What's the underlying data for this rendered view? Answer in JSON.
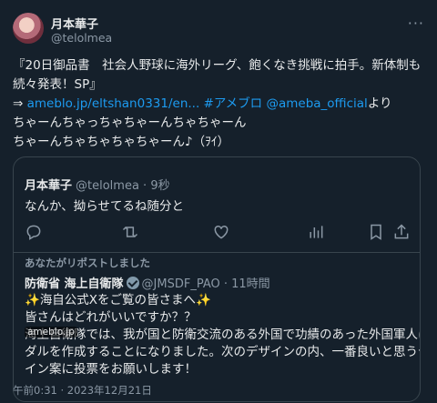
{
  "author": {
    "name": "月本華子",
    "handle": "@telolmea"
  },
  "tweet": {
    "line1": "『20日御品書　社会人野球に海外リーグ、飽くなき挑戦に拍手。新体制も",
    "line2": "続々発表！SP』",
    "arrow": "⇒ ",
    "link": "ameblo.jp/eltshan0331/en...",
    "hashtag": " #アメブロ",
    "mention": " @ameba_official",
    "suffix": "より",
    "line4": "ちゃーんちゃっちゃちゃーんちゃちゃーん",
    "line5": "ちゃーんちゃちゃちゃちゃーん♪（ｦｲ）"
  },
  "quote": {
    "name": "月本華子",
    "meta": "@telolmea · 9秒",
    "text": "なんか、拗らせてるね随分と",
    "repost_label": "あなたがリポストしました",
    "reposted": {
      "name": "防衛省 海上自衛隊",
      "meta": "@JMSDF_PAO · 11時間",
      "line1_sparkle_l": "✨",
      "line1": "海自公式Xをご覧の皆さまへ",
      "line1_sparkle_r": "✨",
      "line2": "皆さんはどれがいいですか？？",
      "line3": "海上自衛隊では、我が国と防衛交流のある外国で功績のあった外国軍人に",
      "line4": "ダルを作成することになりました。次のデザインの内、一番良いと思うデ",
      "line5": "イン案に投票をお願いします！",
      "watermark": "ameblo.jp"
    }
  },
  "actions": [
    "reply-icon",
    "repost-icon",
    "like-icon",
    "views-icon",
    "bookmark-icon",
    "share-icon"
  ],
  "timestamp": "午前0:31 · 2023年12月21日"
}
